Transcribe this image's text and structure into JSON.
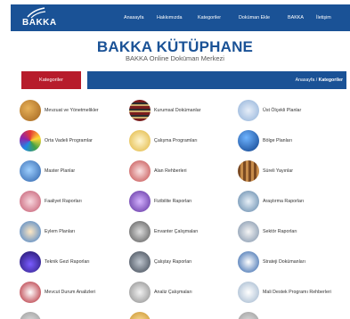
{
  "header": {
    "logo_text": "BAKKA",
    "nav": [
      "Anasayfa",
      "Hakkımızda",
      "Kategoriler",
      "Doküman Ekle",
      "BAKKA",
      "İletişim"
    ]
  },
  "hero": {
    "title": "BAKKA KÜTÜPHANE",
    "subtitle": "BAKKA Online Doküman Merkezi"
  },
  "category_bar": {
    "button": "Kategoriler",
    "breadcrumb_home": "Anasayfa",
    "breadcrumb_sep": " / ",
    "breadcrumb_current": "Kategoriler"
  },
  "categories": [
    [
      "Mevzuat ve Yönetmelikler",
      "Kurumsal Dokümanlar",
      "Üst Ölçekli Planlar"
    ],
    [
      "Orta Vadeli Programlar",
      "Çalışma Programları",
      "Bölge Planları"
    ],
    [
      "Master Planlar",
      "Alan Rehberleri",
      "Süreli Yayınlar"
    ],
    [
      "Faaliyet Raporları",
      "Fizibilite Raporları",
      "Araştırma Raporları"
    ],
    [
      "Eylem Planları",
      "Envanter Çalışmaları",
      "Sektör Raporları"
    ],
    [
      "Teknik Gezi Raporları",
      "Çalıştay Raporları",
      "Strateji Dokümanları"
    ],
    [
      "Mevcut Durum Analizleri",
      "Analiz Çalışmaları",
      "Mali Destek Programı Rehberleri"
    ]
  ],
  "colors": {
    "primary": "#1a5296",
    "accent": "#b71c2b"
  }
}
